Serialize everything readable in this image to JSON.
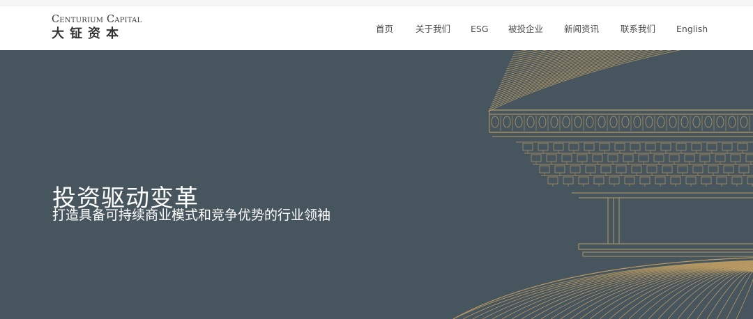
{
  "brand": {
    "name_en": "Centurium Capital",
    "name_cn": "大钲资本"
  },
  "nav": {
    "items": [
      {
        "label": "首页"
      },
      {
        "label": "关于我们"
      },
      {
        "label": "ESG"
      },
      {
        "label": "被投企业"
      },
      {
        "label": "新闻资讯"
      },
      {
        "label": "联系我们"
      },
      {
        "label": "English"
      }
    ]
  },
  "hero": {
    "title": "投资驱动变革",
    "subtitle": "打造具备可持续商业模式和竞争优势的行业领袖",
    "background_color": "#47555e",
    "line_art_color": "#b99a62",
    "illustration": "temple-roof-line-art"
  }
}
